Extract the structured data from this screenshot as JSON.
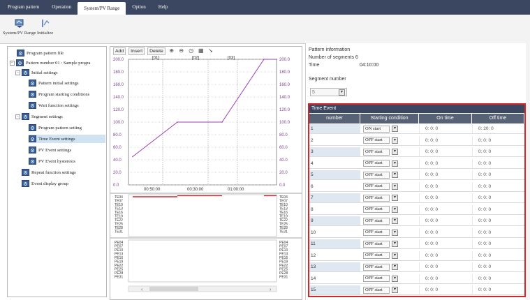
{
  "menu": [
    {
      "label": "Program pattern",
      "active": false
    },
    {
      "label": "Operation",
      "active": false
    },
    {
      "label": "System/PV Range",
      "active": true
    },
    {
      "label": "Option",
      "active": false
    },
    {
      "label": "Help",
      "active": false
    }
  ],
  "toolbar": {
    "system_pv_range": "System/PV Range",
    "initialize": "Initialize"
  },
  "tree": {
    "program_pattern_file": "Program pattern file",
    "pattern_number": "Pattern number 01 : Sample progra",
    "initial_settings": "Initial settings",
    "pattern_initial_settings": "Pattern initial settings",
    "program_starting_conditions": "Program starting conditions",
    "wait_function_settings": "Wait function settings",
    "segment_settings": "Segment settings",
    "program_pattern_setting": "Program pattern setting",
    "time_event_settings": "Time Event settings",
    "pv_event_settings": "PV Event settings",
    "pv_event_hysteresis": "PV Event hysteresis",
    "repeat_function_settings": "Repeat function settings",
    "event_display_group": "Event display group"
  },
  "chart_toolbar": {
    "add": "Add",
    "insert": "Insert",
    "delete": "Delete"
  },
  "chart": {
    "segment_labels": [
      "[01]",
      "[02]",
      "[03]"
    ],
    "y_ticks_left": [
      "200.0",
      "180.0",
      "160.0",
      "140.0",
      "120.0",
      "100.0",
      "80.0",
      "60.0",
      "40.0",
      "20.0",
      "0.0"
    ],
    "y_ticks_right": [
      "200.0",
      "180.0",
      "160.0",
      "140.0",
      "120.0",
      "100.0",
      "80.0",
      "60.0",
      "40.0",
      "20.0",
      "0.0"
    ],
    "x_ticks": [
      "00:50:00",
      "00:30:00",
      "01:00:00"
    ],
    "te_labels": [
      "TE04",
      "TE07",
      "TE10",
      "TE13",
      "TE16",
      "TE19",
      "TE22",
      "TE25",
      "TE28",
      "TE31"
    ],
    "pe_labels": [
      "PE04",
      "PE07",
      "PE10",
      "PE13",
      "PE16",
      "PE19",
      "PE22",
      "PE25",
      "PE28",
      "PE31"
    ]
  },
  "chart_data": {
    "type": "line",
    "title": "",
    "xlabel": "",
    "ylabel": "",
    "ylim": [
      0,
      200
    ],
    "series": [
      {
        "points": [
          [
            0,
            45
          ],
          [
            1,
            100
          ],
          [
            2,
            100
          ],
          [
            3,
            200
          ],
          [
            4,
            200
          ]
        ]
      }
    ]
  },
  "info": {
    "pattern_information": "Pattern information",
    "number_of_segments": "Number of segments 6",
    "time_label": "Time",
    "time_value": "04:10:00",
    "segment_number_label": "Segment number",
    "segment_number_value": "5"
  },
  "time_event": {
    "title": "Time Event",
    "headers": [
      "number",
      "Starting condition",
      "On time",
      "Off time"
    ],
    "rows": [
      {
        "num": "1",
        "cond": "ON start",
        "on": "0:  0:  0",
        "off": "0:  20:  0"
      },
      {
        "num": "2",
        "cond": "OFF start",
        "on": "0:  0:  0",
        "off": "0:  0:  0"
      },
      {
        "num": "3",
        "cond": "OFF start",
        "on": "0:  0:  0",
        "off": "0:  0:  0"
      },
      {
        "num": "4",
        "cond": "OFF start",
        "on": "0:  0:  0",
        "off": "0:  0:  0"
      },
      {
        "num": "5",
        "cond": "OFF start",
        "on": "0:  0:  0",
        "off": "0:  0:  0"
      },
      {
        "num": "6",
        "cond": "OFF start",
        "on": "0:  0:  0",
        "off": "0:  0:  0"
      },
      {
        "num": "7",
        "cond": "OFF start",
        "on": "0:  0:  0",
        "off": "0:  0:  0"
      },
      {
        "num": "8",
        "cond": "OFF start",
        "on": "0:  0:  0",
        "off": "0:  0:  0"
      },
      {
        "num": "9",
        "cond": "OFF start",
        "on": "0:  0:  0",
        "off": "0:  0:  0"
      },
      {
        "num": "10",
        "cond": "OFF start",
        "on": "0:  0:  0",
        "off": "0:  0:  0"
      },
      {
        "num": "11",
        "cond": "OFF start",
        "on": "0:  0:  0",
        "off": "0:  0:  0"
      },
      {
        "num": "12",
        "cond": "OFF start",
        "on": "0:  0:  0",
        "off": "0:  0:  0"
      },
      {
        "num": "13",
        "cond": "OFF start",
        "on": "0:  0:  0",
        "off": "0:  0:  0"
      },
      {
        "num": "14",
        "cond": "OFF start",
        "on": "0:  0:  0",
        "off": "0:  0:  0"
      },
      {
        "num": "15",
        "cond": "OFF start",
        "on": "0:  0:  0",
        "off": "0:  0:  0"
      }
    ]
  },
  "colors": {
    "menubar": "#3b4660",
    "highlight_border": "#d6242b",
    "line": "#9b3fb0",
    "event_bar": "#d6242b"
  }
}
